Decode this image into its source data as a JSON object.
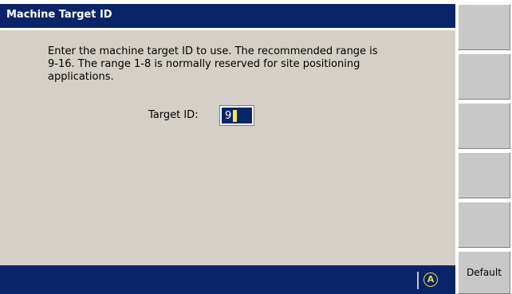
{
  "window": {
    "title": "Machine Target ID"
  },
  "instructions": {
    "line1": "Enter the machine target ID to use. The recommended range is",
    "line2": "9-16. The range 1-8 is normally reserved for site positioning",
    "line3": "applications."
  },
  "target": {
    "label": "Target ID:",
    "value": "9"
  },
  "status": {
    "icon": "circled-a-icon",
    "icon_glyph": "A"
  },
  "softkeys": [
    {
      "label": ""
    },
    {
      "label": ""
    },
    {
      "label": ""
    },
    {
      "label": ""
    },
    {
      "label": ""
    },
    {
      "label": "Default"
    }
  ],
  "colors": {
    "title_bar": "#0a2469",
    "dialog_background": "#d4d0c8",
    "cursor": "#f2e84b"
  }
}
